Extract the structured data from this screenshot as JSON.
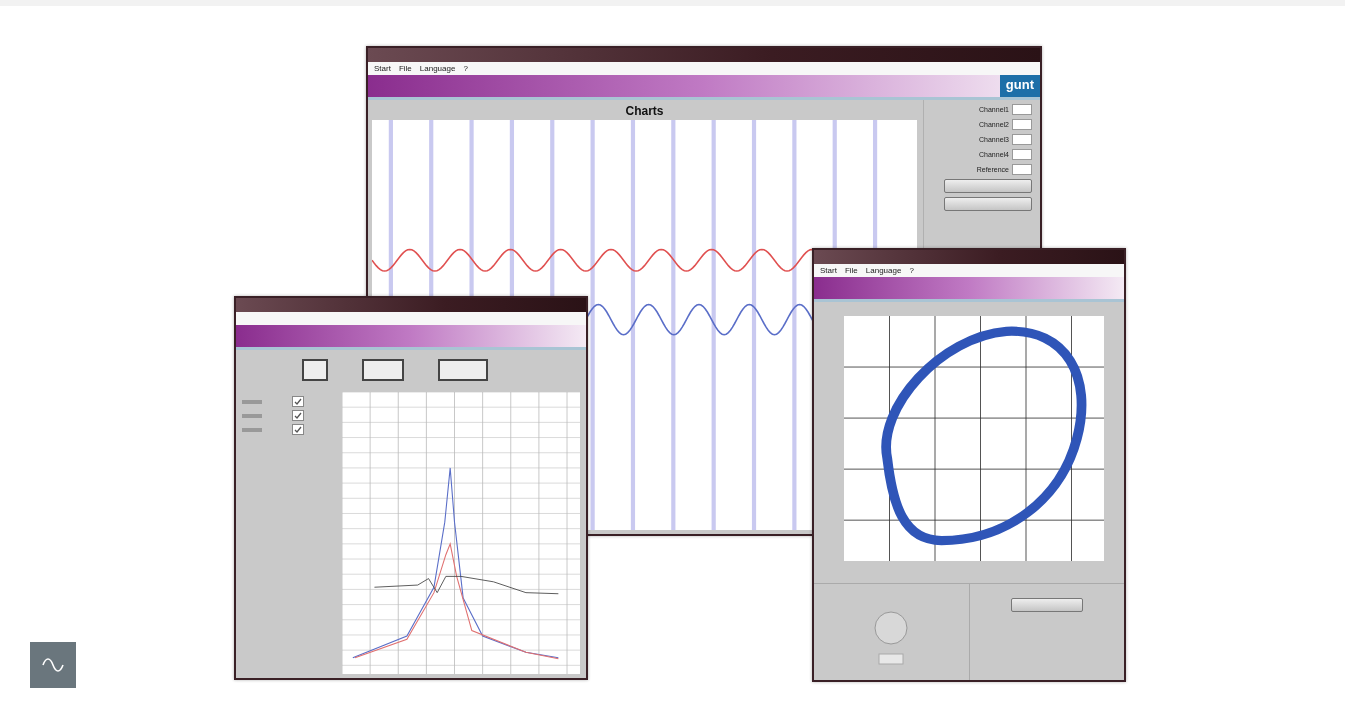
{
  "windows": [
    {
      "kind": "charts",
      "menu": [
        "Start",
        "File",
        "Language",
        "?"
      ],
      "logo": "gunt",
      "chart_title": "Charts",
      "channels": [
        "Channel1",
        "Channel2",
        "Channel3",
        "Channel4",
        "Reference"
      ]
    },
    {
      "kind": "frequency",
      "legend": [
        {
          "checked": true
        },
        {
          "checked": true
        },
        {
          "checked": true
        }
      ]
    },
    {
      "kind": "orbit",
      "menu": [
        "Start",
        "File",
        "Language",
        "?"
      ]
    }
  ]
}
